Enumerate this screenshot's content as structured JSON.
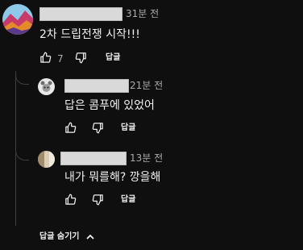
{
  "comment": {
    "time": "31분 전",
    "text": "2차 드립전쟁 시작!!!",
    "like_count": "7",
    "reply_label": "답글"
  },
  "replies": [
    {
      "time": "21분 전",
      "text": "답은 콤푸에 있었어",
      "reply_label": "답글"
    },
    {
      "time": "13분 전",
      "text": "내가 뭐를해? 깡을해",
      "reply_label": "답글"
    }
  ],
  "collapse_label": "답글 숨기기"
}
